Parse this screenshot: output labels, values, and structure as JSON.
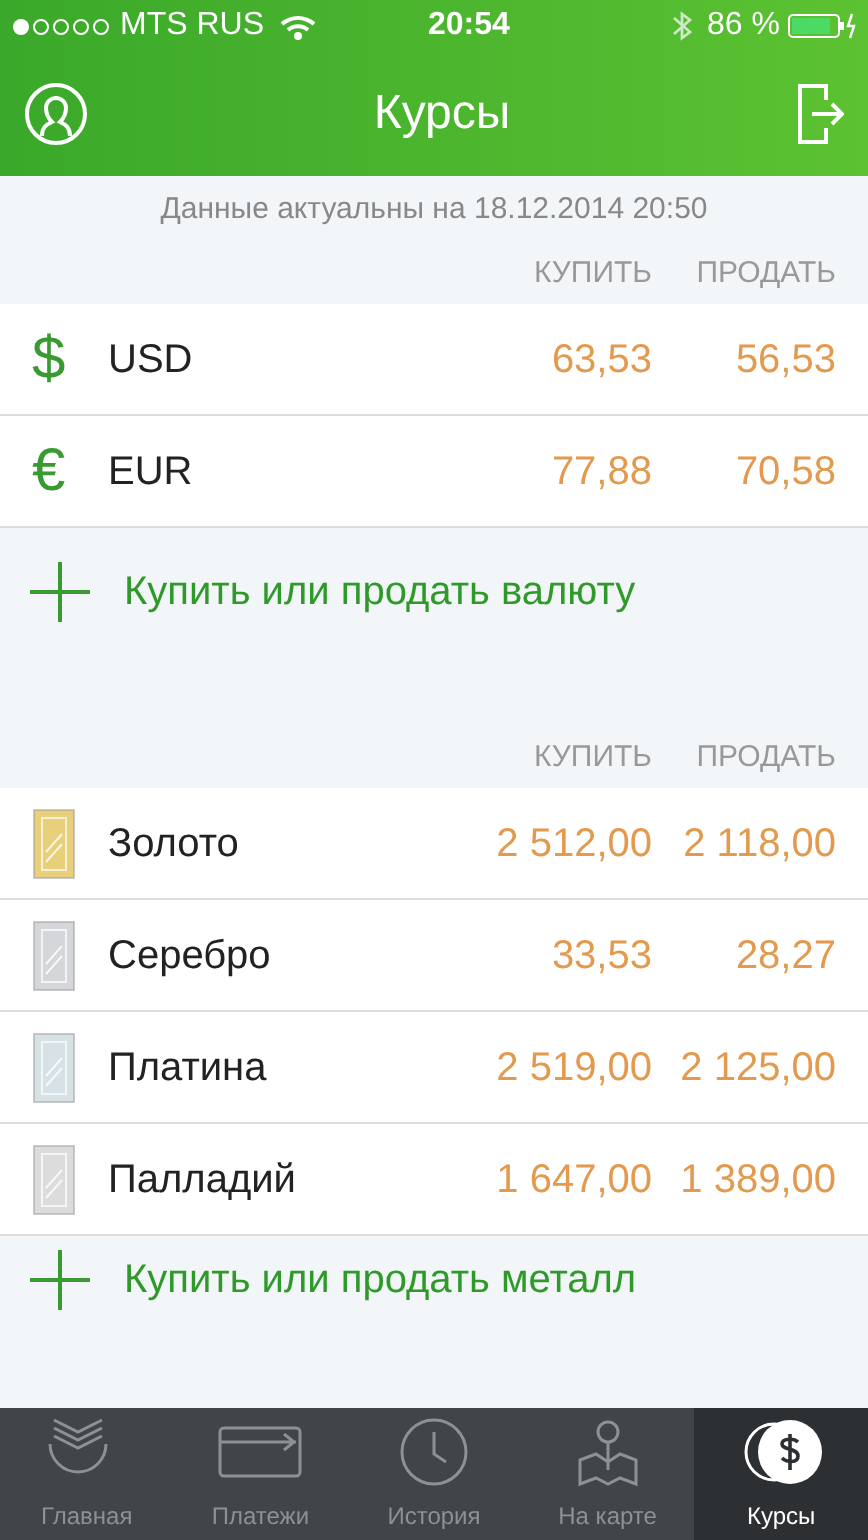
{
  "status_bar": {
    "carrier": "MTS RUS",
    "time": "20:54",
    "battery": "86 %"
  },
  "nav": {
    "title": "Курсы"
  },
  "updated": "Данные актуальны на 18.12.2014 20:50",
  "currencies": {
    "columns": [
      "КУПИТЬ",
      "ПРОДАТЬ"
    ],
    "rows": [
      {
        "symbol": "$",
        "name": "USD",
        "buy": "63,53",
        "sell": "56,53"
      },
      {
        "symbol": "€",
        "name": "EUR",
        "buy": "77,88",
        "sell": "70,58"
      }
    ],
    "action": "Купить или продать валюту"
  },
  "metals": {
    "columns": [
      "КУПИТЬ",
      "ПРОДАТЬ"
    ],
    "rows": [
      {
        "name": "Золото",
        "color": "#e8cf7a",
        "buy": "2 512,00",
        "sell": "2 118,00"
      },
      {
        "name": "Серебро",
        "color": "#d4d6da",
        "buy": "33,53",
        "sell": "28,27"
      },
      {
        "name": "Платина",
        "color": "#d6e2e6",
        "buy": "2 519,00",
        "sell": "2 125,00"
      },
      {
        "name": "Палладий",
        "color": "#dcdcdc",
        "buy": "1 647,00",
        "sell": "1 389,00"
      }
    ],
    "action": "Купить или продать металл"
  },
  "tabs": [
    {
      "kind": "home",
      "label": "Главная",
      "selected": false
    },
    {
      "kind": "card",
      "label": "Платежи",
      "selected": false
    },
    {
      "kind": "clock",
      "label": "История",
      "selected": false
    },
    {
      "kind": "map",
      "label": "На карте",
      "selected": false
    },
    {
      "kind": "coin",
      "label": "Курсы",
      "selected": true
    }
  ]
}
